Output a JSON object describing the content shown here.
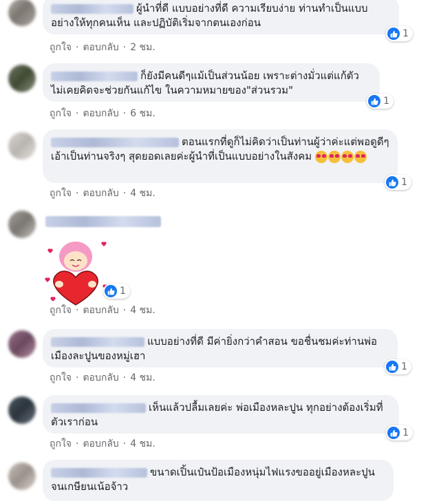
{
  "comments": [
    {
      "text": "ผู้นำที่ดี แบบอย่างที่ดี ความเรียบง่าย ท่านทำเป็นแบบอย่างให้ทุกคนเห็น และปฏิบัติเริ่มจากตนเองก่อน",
      "like_label": "ถูกใจ",
      "reply_label": "ตอบกลับ",
      "time": "2 ชม.",
      "reaction_count": "1"
    },
    {
      "text": "ก็ยังมีคนดีๆแม้เป็นส่วนน้อย เพราะต่างมั่วแต่แก้ตัว ไม่เคยคิดจะช่วยกันแก้ไข ในความหมายของ\"ส่วนรวม\"",
      "like_label": "ถูกใจ",
      "reply_label": "ตอบกลับ",
      "time": "6 ชม.",
      "reaction_count": "1"
    },
    {
      "text": "ตอนแรกที่ดูก็ไม่คิดว่าเป็นท่านผู้ว่าค่ะแต่พอดูดีๆเอ้าเป็นท่านจริงๆ สุดยอดเลยค่ะผู้นำที่เป็นแบบอย่างในสังคม",
      "like_label": "ถูกใจ",
      "reply_label": "ตอบกลับ",
      "time": "4 ชม.",
      "reaction_count": "1"
    },
    {
      "text": "",
      "like_label": "ถูกใจ",
      "reply_label": "ตอบกลับ",
      "time": "4 ชม.",
      "reaction_count": "1"
    },
    {
      "text": "แบบอย่างที่ดี มีค่ายิ่งกว่าคำสอน ขอชื่นชมค่ะท่านพ่อเมืองละปูนของหมู่เฮา",
      "like_label": "ถูกใจ",
      "reply_label": "ตอบกลับ",
      "time": "4 ชม.",
      "reaction_count": "1"
    },
    {
      "text": "เห็นแล้วปลื้มเลยค่ะ พ่อเมืองหละปูน ทุกอย่างต้องเริ่มที่ตัวเราก่อน",
      "like_label": "ถูกใจ",
      "reply_label": "ตอบกลับ",
      "time": "4 ชม.",
      "reaction_count": "1"
    },
    {
      "text": "ขนาดเปิ้นเป๋นป้อเมืองหนุ่มไฟแรงขออยู่เมืองหละปูนจนเกษียนเน้อจ้าว"
    }
  ],
  "icons": {
    "like": "like-thumb-icon",
    "emoji": "heart-eyes-emoji"
  },
  "colors": {
    "bubble": "#f0f2f5",
    "like_blue": "#1877f2",
    "meta_gray": "#65676b"
  }
}
